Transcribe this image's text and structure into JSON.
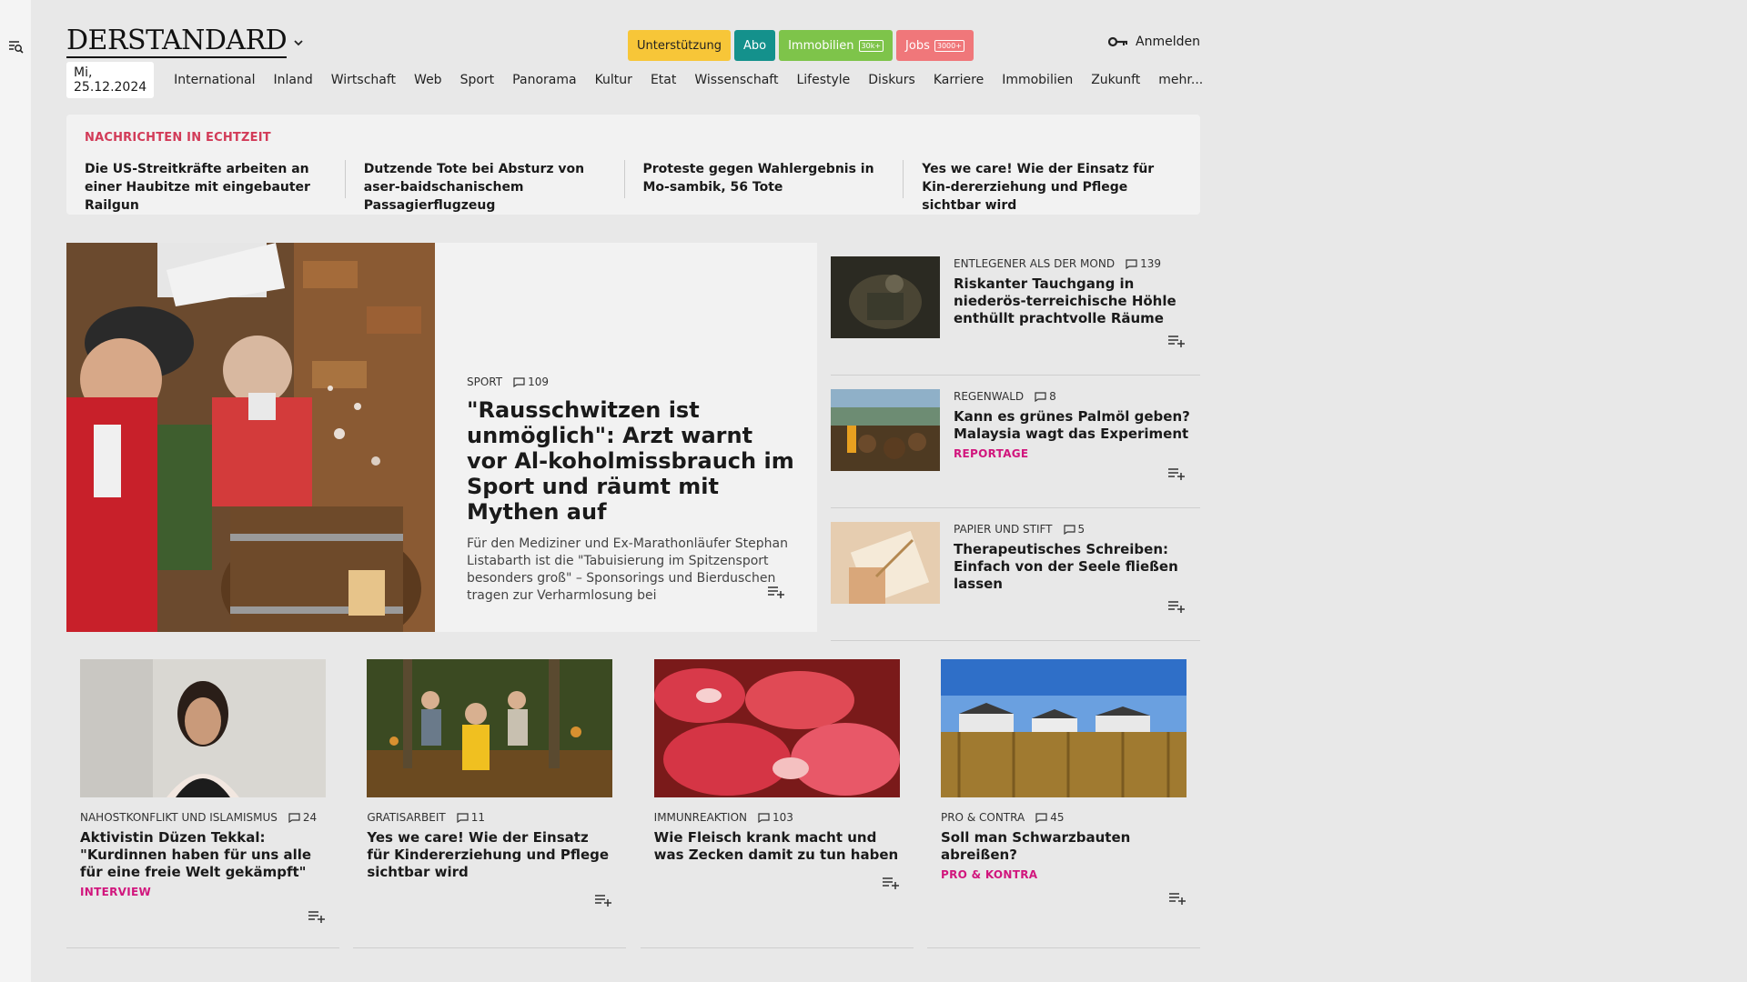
{
  "header": {
    "logo": "DERSTANDARD",
    "pills": [
      {
        "label": "Unterstützung",
        "bg": "#f7c638",
        "fg": "#222",
        "badge": ""
      },
      {
        "label": "Abo",
        "bg": "#14918c",
        "fg": "#ffffff",
        "badge": ""
      },
      {
        "label": "Immobilien",
        "bg": "#7ec44a",
        "fg": "#ffffff",
        "badge": "30k+"
      },
      {
        "label": "Jobs",
        "bg": "#f0777a",
        "fg": "#ffffff",
        "badge": "3000+"
      }
    ],
    "login_label": "Anmelden"
  },
  "nav": {
    "date": "Mi, 25.12.2024",
    "items": [
      "International",
      "Inland",
      "Wirtschaft",
      "Web",
      "Sport",
      "Panorama",
      "Kultur",
      "Etat",
      "Wissenschaft",
      "Lifestyle",
      "Diskurs",
      "Karriere",
      "Immobilien",
      "Zukunft",
      "mehr..."
    ]
  },
  "ticker": {
    "title": "NACHRICHTEN IN ECHTZEIT",
    "items": [
      "Die US-Streitkräfte arbeiten an einer Haubitze mit eingebauter Railgun",
      "Dutzende Tote bei Absturz von aser-baidschanischem Passagierflugzeug",
      "Proteste gegen Wahlergebnis in Mo-sambik, 56 Tote",
      "Yes we care! Wie der Einsatz für Kin-dererziehung und Pflege sichtbar wird"
    ]
  },
  "hero": {
    "kicker": "SPORT",
    "comments": "109",
    "title": "\"Rausschwitzen ist unmöglich\": Arzt warnt vor Al-koholmissbrauch im Sport und räumt mit Mythen auf",
    "desc": "Für den Mediziner und Ex-Marathonläufer Stephan Listabarth ist die \"Tabuisierung im Spitzensport besonders groß\" – Sponsorings und Bierduschen tragen zur Verharmlosung bei"
  },
  "side": [
    {
      "kicker": "ENTLEGENER ALS DER MOND",
      "comments": "139",
      "title": "Riskanter Tauchgang in niederös-terreichische Höhle enthüllt prachtvolle Räume",
      "tag": ""
    },
    {
      "kicker": "REGENWALD",
      "comments": "8",
      "title": "Kann es grünes Palmöl geben? Malaysia wagt das Experiment",
      "tag": "REPORTAGE"
    },
    {
      "kicker": "PAPIER UND STIFT",
      "comments": "5",
      "title": "Therapeutisches Schreiben: Einfach von der Seele fließen lassen",
      "tag": ""
    }
  ],
  "cards": [
    {
      "kicker": "NAHOSTKONFLIKT UND ISLAMISMUS",
      "comments": "24",
      "title": "Aktivistin Düzen Tekkal: \"Kurdinnen haben für uns alle für eine freie Welt gekämpft\"",
      "tag": "INTERVIEW"
    },
    {
      "kicker": "GRATISARBEIT",
      "comments": "11",
      "title": "Yes we care! Wie der Einsatz für Kindererziehung und Pflege sichtbar wird",
      "tag": ""
    },
    {
      "kicker": "IMMUNREAKTION",
      "comments": "103",
      "title": "Wie Fleisch krank macht und was Zecken damit zu tun haben",
      "tag": ""
    },
    {
      "kicker": "PRO & CONTRA",
      "comments": "45",
      "title": "Soll man Schwarzbauten abreißen?",
      "tag": "PRO & KONTRA"
    }
  ],
  "icons": {
    "menu": "search-menu-icon",
    "chevron": "chevron-down-icon",
    "key": "key-icon",
    "comment": "comment-icon",
    "playlist": "playlist-add-icon"
  }
}
